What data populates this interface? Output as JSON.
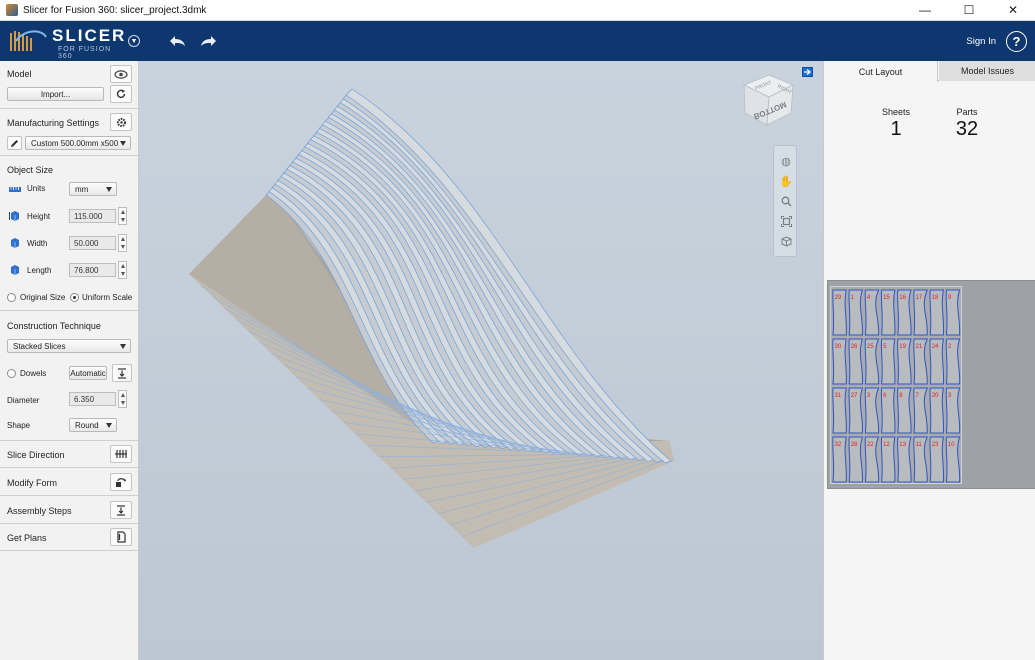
{
  "window": {
    "title": "Slicer for Fusion 360: slicer_project.3dmk",
    "min": "—",
    "max": "☐",
    "close": "✕"
  },
  "header": {
    "logo_name": "SLICER",
    "logo_sub": "FOR FUSION 360",
    "signin": "Sign In",
    "help": "?"
  },
  "left": {
    "model": {
      "title": "Model",
      "import_label": "Import..."
    },
    "manufacturing": {
      "title": "Manufacturing Settings",
      "preset": "Custom  500.00mm x500.0"
    },
    "object_size": {
      "title": "Object Size",
      "units_label": "Units",
      "units_value": "mm",
      "height_label": "Height",
      "height_value": "115.000",
      "width_label": "Width",
      "width_value": "50.000",
      "length_label": "Length",
      "length_value": "76.800",
      "original_scale": "Original Size",
      "uniform_scale": "Uniform Scale"
    },
    "construction": {
      "title": "Construction Technique",
      "technique": "Stacked Slices",
      "dowels_label": "Dowels",
      "dowels_mode": "Automatic",
      "diameter_label": "Diameter",
      "diameter_value": "6.350",
      "shape_label": "Shape",
      "shape_value": "Round"
    },
    "slice_direction": "Slice Direction",
    "modify_form": "Modify Form",
    "assembly_steps": "Assembly Steps",
    "get_plans": "Get Plans"
  },
  "viewcube": {
    "front": "FRONT",
    "right": "RIGHT",
    "bottom": "BOTTOM"
  },
  "right": {
    "tab_cut_layout": "Cut Layout",
    "tab_model_issues": "Model Issues",
    "sheets_label": "Sheets",
    "sheets_value": "1",
    "parts_label": "Parts",
    "parts_value": "32"
  },
  "colors": {
    "header_bg": "#0e3770",
    "accent": "#1a6fd0",
    "part_outline": "#2e55c9",
    "part_label": "#e02020"
  }
}
